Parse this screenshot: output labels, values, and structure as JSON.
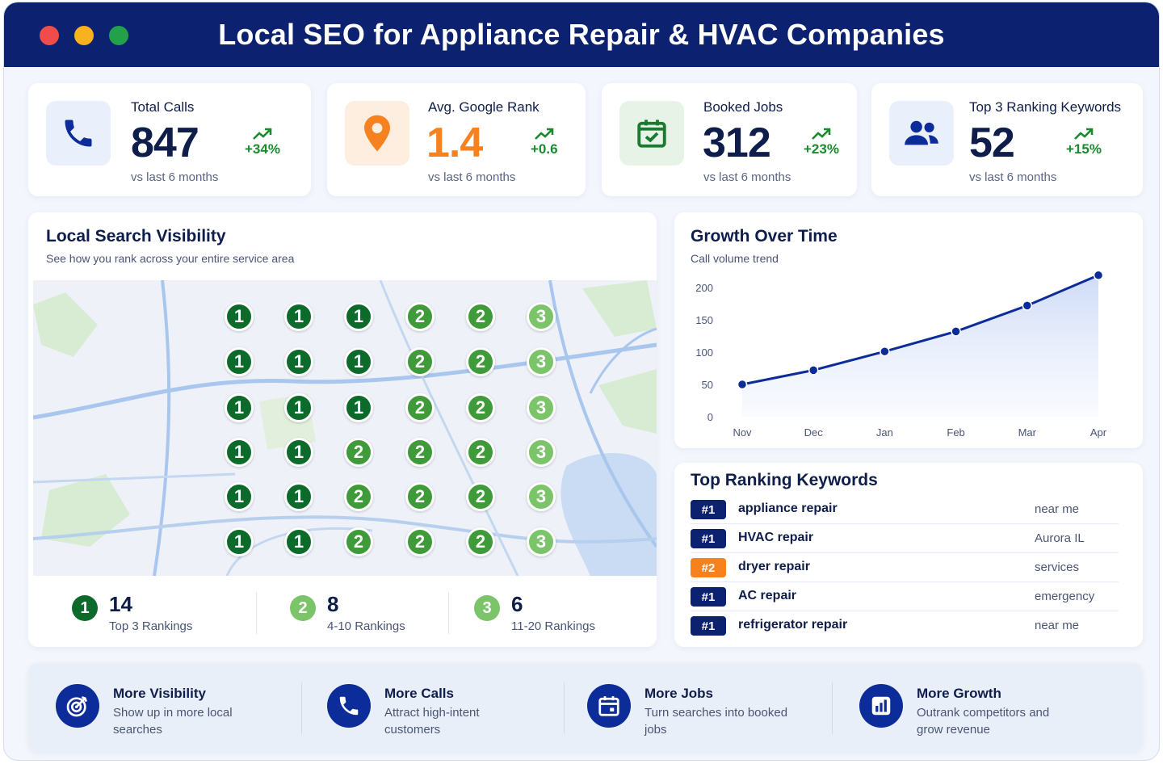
{
  "header": {
    "title": "Local SEO for Appliance Repair & HVAC Companies",
    "window_dots": [
      "#f04d4a",
      "#f7b21e",
      "#22a04a"
    ]
  },
  "kpis": [
    {
      "title": "Total Calls",
      "value": "847",
      "delta": "+34%",
      "sub": "vs last 6 months",
      "icon": "phone-icon",
      "color": "#0c2c9a"
    },
    {
      "title": "Avg. Google Rank",
      "value": "1.4",
      "delta": "+0.6",
      "sub": "vs last 6 months",
      "icon": "map-pin-icon",
      "color": "#f5821f"
    },
    {
      "title": "Booked Jobs",
      "value": "312",
      "delta": "+23%",
      "sub": "vs last 6 months",
      "icon": "calendar-check-icon",
      "color": "#1a7a30"
    },
    {
      "title": "Top 3 Ranking Keywords",
      "value": "52",
      "delta": "+15%",
      "sub": "vs last 6 months",
      "icon": "users-icon",
      "color": "#0c2c9a"
    }
  ],
  "visibility": {
    "title": "Local Search Visibility",
    "subtitle": "See how you rank across your entire service area",
    "grid": [
      [
        1,
        1,
        1,
        2,
        2,
        3
      ],
      [
        1,
        1,
        1,
        2,
        2,
        3
      ],
      [
        1,
        1,
        1,
        2,
        2,
        3
      ],
      [
        1,
        1,
        2,
        2,
        2,
        3
      ],
      [
        1,
        1,
        2,
        2,
        2,
        3
      ],
      [
        1,
        1,
        2,
        2,
        2,
        3
      ]
    ],
    "legend": [
      {
        "badge": "1",
        "count": "14",
        "label": "Top 3 Rankings"
      },
      {
        "badge": "2",
        "count": "8",
        "label": "4-10 Rankings"
      },
      {
        "badge": "3",
        "count": "6",
        "label": "11-20 Rankings"
      }
    ]
  },
  "growth": {
    "title": "Growth Over Time",
    "subtitle": "Call volume trend"
  },
  "chart_data": {
    "type": "line",
    "title": "Growth Over Time",
    "subtitle": "Call volume trend",
    "categories": [
      "Nov",
      "Dec",
      "Jan",
      "Feb",
      "Mar",
      "Apr"
    ],
    "series": [
      {
        "values": [
          50,
          72,
          101,
          132,
          172,
          219
        ]
      }
    ],
    "yticks": [
      0,
      50,
      100,
      150,
      200
    ],
    "ylim": [
      0,
      210
    ],
    "grid": false,
    "area_fill": true,
    "color": "#0c2c9a"
  },
  "keywords": {
    "title": "Top Ranking Keywords",
    "rows": [
      {
        "rank": "#1",
        "name": "appliance repair",
        "modifier": "near me",
        "color": "#0c2170"
      },
      {
        "rank": "#1",
        "name": "HVAC repair",
        "modifier": "Aurora IL",
        "color": "#0c2170"
      },
      {
        "rank": "#2",
        "name": "dryer repair",
        "modifier": "services",
        "color": "#f5821f"
      },
      {
        "rank": "#1",
        "name": "AC repair",
        "modifier": "emergency",
        "color": "#0c2170"
      },
      {
        "rank": "#1",
        "name": "refrigerator repair",
        "modifier": "near me",
        "color": "#0c2170"
      }
    ]
  },
  "benefits": [
    {
      "title": "More Visibility",
      "desc": "Show up in more local searches",
      "icon": "target-icon"
    },
    {
      "title": "More Calls",
      "desc": "Attract high-intent customers",
      "icon": "phone-icon"
    },
    {
      "title": "More Jobs",
      "desc": "Turn searches into booked jobs",
      "icon": "calendar-icon"
    },
    {
      "title": "More Growth",
      "desc": "Outrank competitors and grow revenue",
      "icon": "bar-chart-icon"
    }
  ]
}
